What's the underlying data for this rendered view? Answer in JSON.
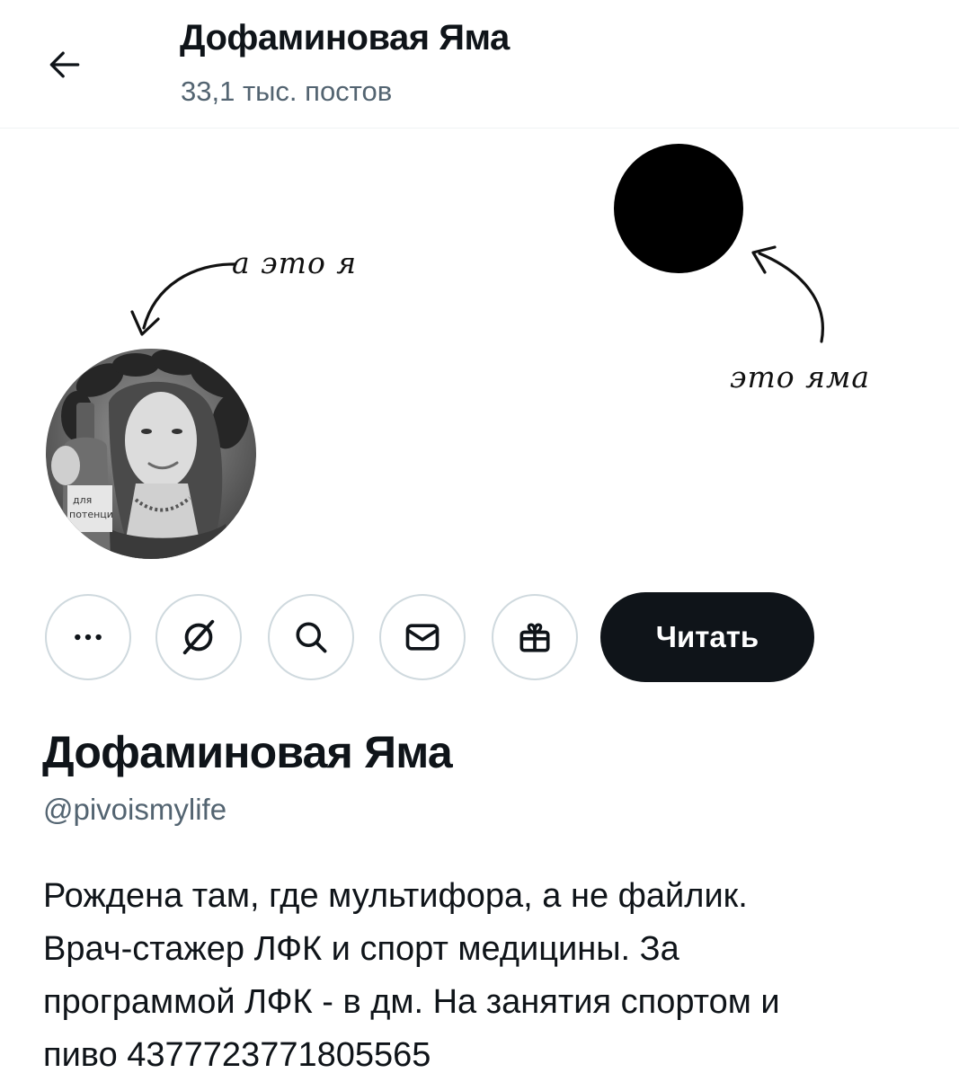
{
  "header": {
    "title": "Дофаминовая Яма",
    "post_count": "33,1 тыс. постов"
  },
  "banner": {
    "label_me": "а это я",
    "label_pit": "это яма"
  },
  "avatar": {
    "bottle_label_line1": "для",
    "bottle_label_line2": "потенци"
  },
  "actions": {
    "more_icon": "more-horizontal-icon",
    "grok_icon": "grok-slash-icon",
    "search_icon": "search-icon",
    "message_icon": "envelope-icon",
    "gift_icon": "gift-icon",
    "follow_label": "Читать"
  },
  "profile": {
    "display_name": "Дофаминовая Яма",
    "handle": "@pivoismylife",
    "bio_lines": [
      "Рождена там, где мультифора, а не файлик.",
      "Врач-стажер ЛФК и спорт медицины. За",
      "программой ЛФК - в дм. На занятия спортом и",
      "пиво 4377723771805565"
    ]
  },
  "colors": {
    "text_primary": "#0f1419",
    "text_secondary": "#536471",
    "border": "#cfd9de",
    "button_dark": "#0f1419"
  }
}
